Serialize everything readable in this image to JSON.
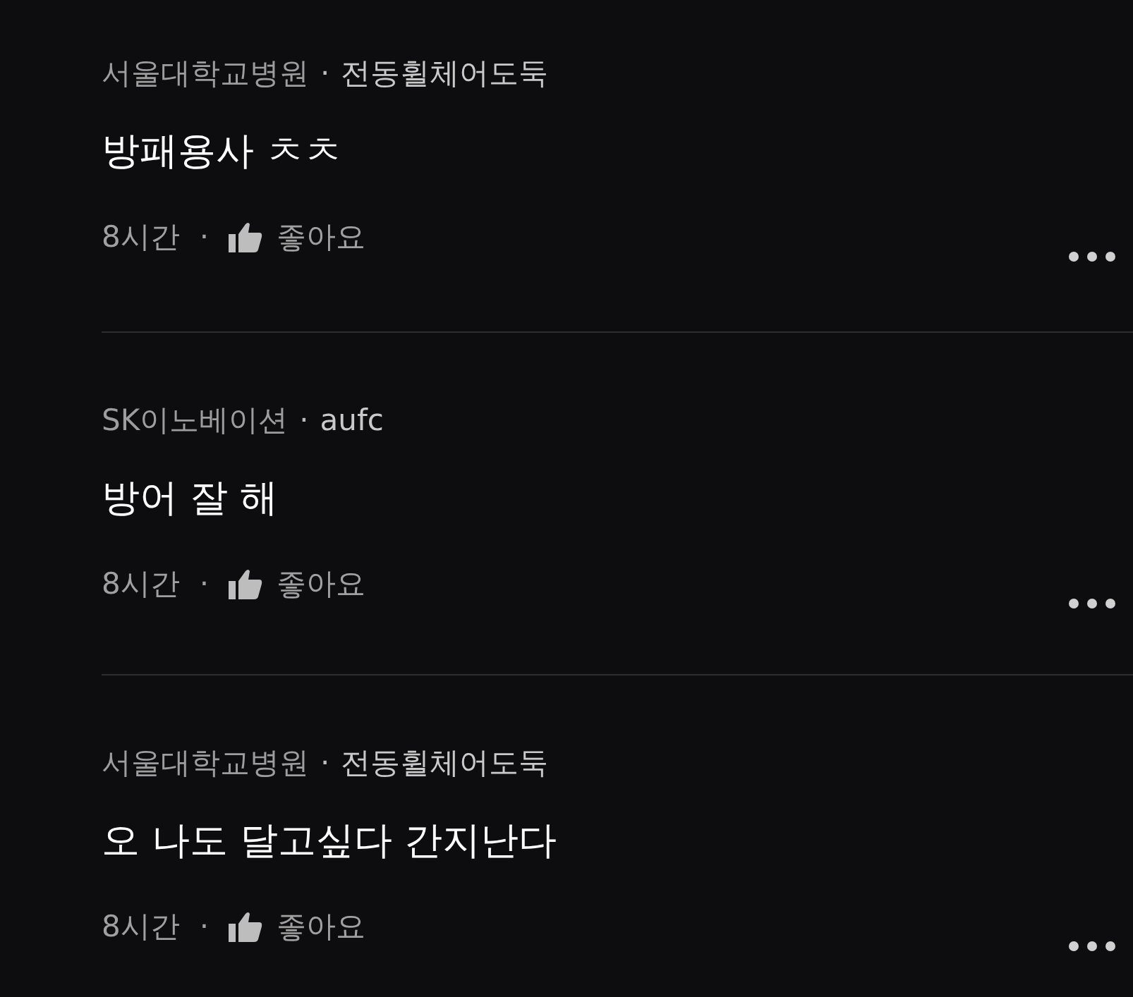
{
  "comments": [
    {
      "company": "서울대학교병원",
      "separator": "·",
      "author": "전동휠체어도둑",
      "text": "방패용사 ㅊㅊ",
      "time": "8시간",
      "dot": "·",
      "like_label": "좋아요"
    },
    {
      "company": "SK이노베이션",
      "separator": "·",
      "author": "aufc",
      "text": "방어 잘 해",
      "time": "8시간",
      "dot": "·",
      "like_label": "좋아요"
    },
    {
      "company": "서울대학교병원",
      "separator": "·",
      "author": "전동휠체어도둑",
      "text": "오 나도 달고싶다 간지난다",
      "time": "8시간",
      "dot": "·",
      "like_label": "좋아요"
    }
  ]
}
